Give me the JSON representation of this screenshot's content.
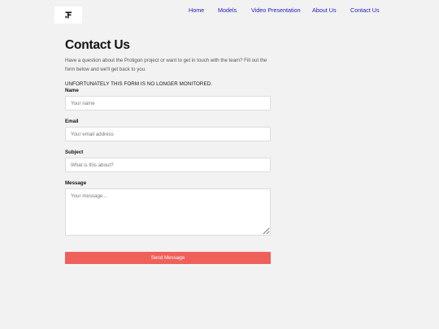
{
  "header": {
    "logo_icon": "brand-logo-icon",
    "nav": [
      {
        "label": "Home"
      },
      {
        "label": "Models"
      },
      {
        "label": "Video Presentation"
      },
      {
        "label": "About Us"
      },
      {
        "label": "Contact Us"
      }
    ],
    "link_color": "#2020c0"
  },
  "main": {
    "title": "Contact Us",
    "intro": "Have a question about the Protigon project or want to get in touch with the team? Fill out the form below and we'll get back to you.",
    "notice": "UNFORTUNATELY THIS FORM IS NO LONGER MONITORED."
  },
  "form": {
    "name": {
      "label": "Name",
      "placeholder": "Your name",
      "value": ""
    },
    "email": {
      "label": "Email",
      "placeholder": "Your email address",
      "value": ""
    },
    "subject": {
      "label": "Subject",
      "placeholder": "What is this about?",
      "value": ""
    },
    "message": {
      "label": "Message",
      "placeholder": "Your message...",
      "value": ""
    },
    "submit_label": "Send Message",
    "submit_color": "#f0605a"
  }
}
